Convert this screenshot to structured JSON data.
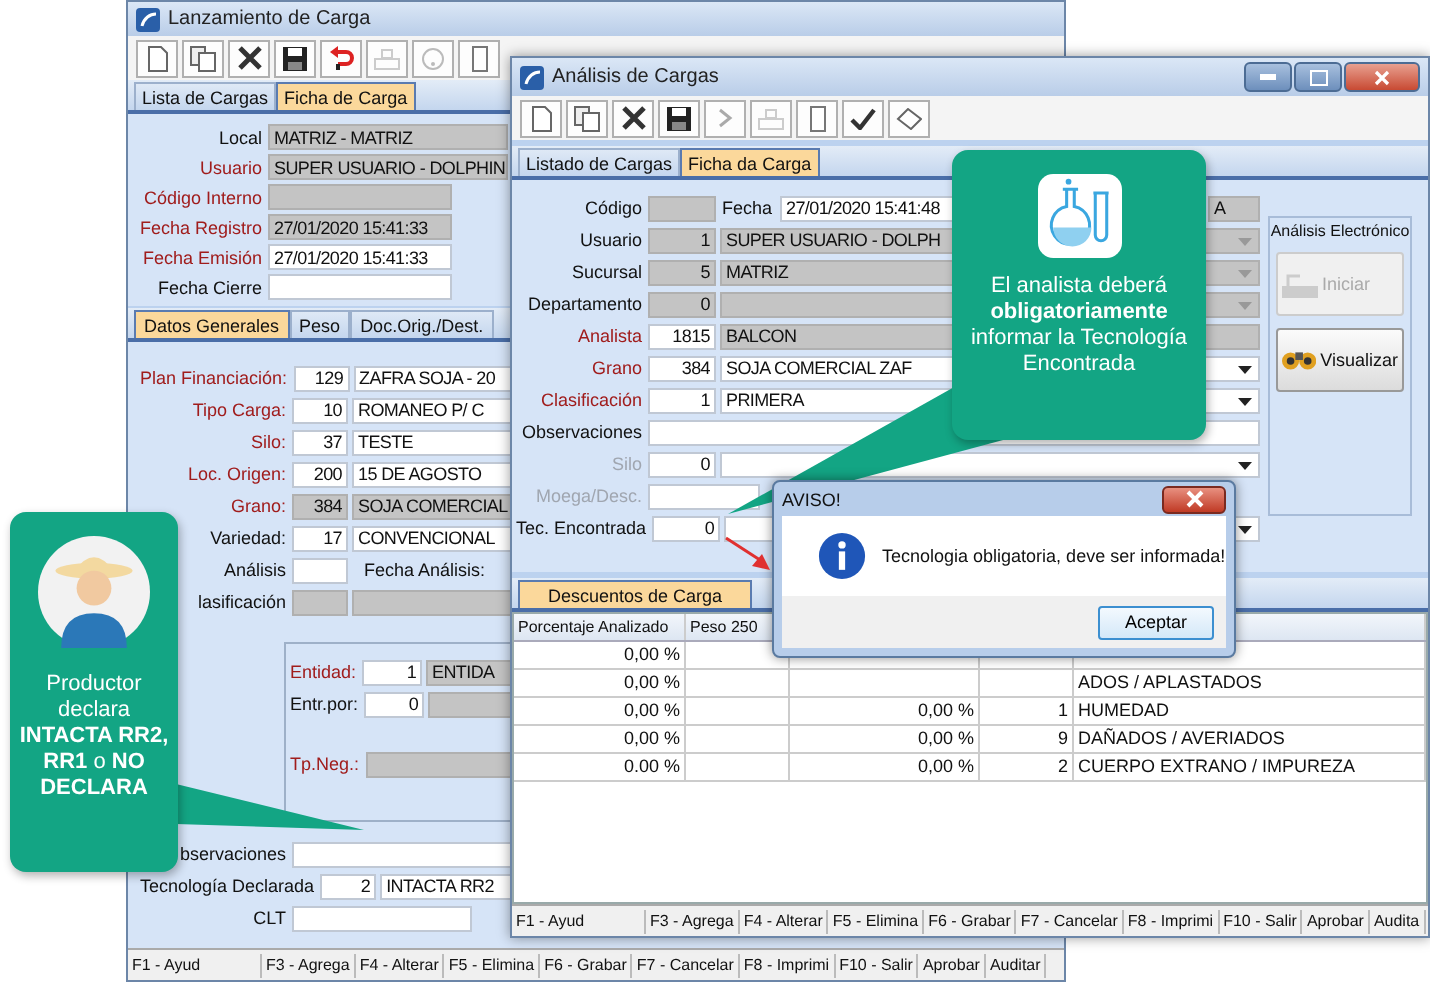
{
  "left_window": {
    "title": "Lanzamiento de Carga",
    "tabs": [
      {
        "label": "Lista de Cargas",
        "selected": false
      },
      {
        "label": "Ficha de Carga",
        "selected": true
      }
    ],
    "header_fields": [
      {
        "label": "Local",
        "required": false,
        "parts": [
          {
            "kind": "text",
            "value": "MATRIZ - MATRIZ",
            "readonly": true
          }
        ]
      },
      {
        "label": "Usuario",
        "required": true,
        "parts": [
          {
            "kind": "text",
            "value": "SUPER USUARIO - DOLPHIN",
            "readonly": true
          }
        ]
      },
      {
        "label": "Código Interno",
        "required": true,
        "parts": [
          {
            "kind": "date",
            "readonly": true
          }
        ]
      },
      {
        "label": "Fecha Registro",
        "required": true,
        "parts": [
          {
            "kind": "date",
            "value": "27/01/2020 15:41:33",
            "readonly": true
          }
        ]
      },
      {
        "label": "Fecha Emisión",
        "required": true,
        "parts": [
          {
            "kind": "date",
            "value": "27/01/2020 15:41:33",
            "readonly": false
          }
        ]
      },
      {
        "label": "Fecha Cierre",
        "required": false,
        "parts": [
          {
            "kind": "date",
            "readonly": false
          }
        ]
      }
    ],
    "subtabs": [
      {
        "label": "Datos Generales",
        "selected": true
      },
      {
        "label": "Peso",
        "selected": false
      },
      {
        "label": "Doc.Orig./Dest.",
        "selected": false
      }
    ],
    "fields": [
      {
        "label": "Plan Financiación:",
        "required": true,
        "parts": [
          {
            "kind": "code",
            "value": "129",
            "readonly": false
          },
          {
            "kind": "text",
            "value": "ZAFRA SOJA - 20",
            "readonly": false
          }
        ]
      },
      {
        "label": "Tipo Carga:",
        "required": true,
        "parts": [
          {
            "kind": "code",
            "value": "10",
            "readonly": false
          },
          {
            "kind": "text",
            "value": "ROMANEO P/ C",
            "readonly": false
          }
        ]
      },
      {
        "label": "Silo:",
        "required": true,
        "parts": [
          {
            "kind": "code",
            "value": "37",
            "readonly": false
          },
          {
            "kind": "text",
            "value": "TESTE",
            "readonly": false
          }
        ]
      },
      {
        "label": "Loc. Origen:",
        "required": true,
        "parts": [
          {
            "kind": "code",
            "value": "200",
            "readonly": false
          },
          {
            "kind": "text",
            "value": "15 DE AGOSTO",
            "readonly": false
          }
        ]
      },
      {
        "label": "Grano:",
        "required": true,
        "parts": [
          {
            "kind": "code",
            "value": "384",
            "readonly": true
          },
          {
            "kind": "text",
            "value": "SOJA COMERCIAL",
            "readonly": true
          }
        ]
      },
      {
        "label": "Variedad:",
        "required": false,
        "parts": [
          {
            "kind": "code",
            "value": "17",
            "readonly": false
          },
          {
            "kind": "text",
            "value": "CONVENCIONAL",
            "readonly": false
          }
        ]
      },
      {
        "label": "Análisis",
        "required": false,
        "parts": [
          {
            "kind": "code",
            "readonly": false
          },
          {
            "kind": "label",
            "value": "Fecha Análisis:"
          }
        ]
      },
      {
        "label": "lasificación",
        "required": false,
        "parts": [
          {
            "kind": "code",
            "readonly": true
          },
          {
            "kind": "text",
            "readonly": true
          }
        ]
      }
    ],
    "entity_group": [
      {
        "label": "Entidad:",
        "required": true,
        "parts": [
          {
            "kind": "code",
            "value": "1",
            "readonly": false
          },
          {
            "kind": "text",
            "value": "ENTIDA",
            "readonly": true
          }
        ]
      },
      {
        "label": "Entr.por:",
        "required": false,
        "parts": [
          {
            "kind": "code",
            "value": "0",
            "readonly": false
          },
          {
            "kind": "text",
            "readonly": true
          }
        ]
      },
      {
        "label": "Tp.Neg.:",
        "required": true,
        "parts": [
          {
            "kind": "text",
            "readonly": true
          }
        ]
      }
    ],
    "bottom_fields": [
      {
        "label": "bservaciones",
        "required": false,
        "parts": [
          {
            "kind": "text",
            "readonly": false
          }
        ]
      },
      {
        "label": "Tecnología Declarada",
        "required": false,
        "parts": [
          {
            "kind": "code",
            "value": "2",
            "readonly": false
          },
          {
            "kind": "text",
            "value": "INTACTA RR2",
            "readonly": false
          }
        ]
      },
      {
        "label": "CLT",
        "required": false,
        "parts": [
          {
            "kind": "date",
            "readonly": false
          }
        ]
      }
    ],
    "status_bar": [
      "F1 - Ayud",
      "F3 - Agrega",
      "F4 - Alterar",
      "F5 - Elimina",
      "F6 - Grabar",
      "F7 - Cancelar",
      "F8 - Imprimi",
      "F10 - Salir",
      "Aprobar",
      "Auditar"
    ]
  },
  "right_window": {
    "title": "Análisis de Cargas",
    "tabs": [
      {
        "label": "Listado de Cargas",
        "selected": false
      },
      {
        "label": "Ficha da Carga",
        "selected": true
      }
    ],
    "fields": [
      {
        "label": "Código",
        "required": false,
        "disabled": false,
        "parts": [
          {
            "kind": "code",
            "readonly": true
          },
          {
            "kind": "label",
            "value": "Fecha"
          },
          {
            "kind": "date",
            "value": "27/01/2020 15:41:48",
            "readonly": false
          },
          {
            "kind": "tail",
            "value": "A",
            "readonly": true
          }
        ]
      },
      {
        "label": "Usuario",
        "required": false,
        "disabled": false,
        "parts": [
          {
            "kind": "code",
            "value": "1",
            "readonly": true
          },
          {
            "kind": "text",
            "value": "SUPER USUARIO - DOLPH",
            "readonly": true,
            "dropdown": true
          }
        ]
      },
      {
        "label": "Sucursal",
        "required": false,
        "disabled": false,
        "parts": [
          {
            "kind": "code",
            "value": "5",
            "readonly": true
          },
          {
            "kind": "text",
            "value": "MATRIZ",
            "readonly": true,
            "dropdown": true
          }
        ]
      },
      {
        "label": "Departamento",
        "required": false,
        "disabled": false,
        "parts": [
          {
            "kind": "code",
            "value": "0",
            "readonly": true
          },
          {
            "kind": "text",
            "readonly": true,
            "dropdown": true
          }
        ]
      },
      {
        "label": "Analista",
        "required": true,
        "disabled": false,
        "parts": [
          {
            "kind": "code",
            "value": "1815",
            "readonly": false
          },
          {
            "kind": "text",
            "value": "BALCON",
            "readonly": true
          }
        ]
      },
      {
        "label": "Grano",
        "required": true,
        "disabled": false,
        "parts": [
          {
            "kind": "code",
            "value": "384",
            "readonly": false
          },
          {
            "kind": "text",
            "value": "SOJA COMERCIAL ZAF",
            "readonly": false,
            "dropdown": true
          }
        ]
      },
      {
        "label": "Clasificación",
        "required": true,
        "disabled": false,
        "parts": [
          {
            "kind": "code",
            "value": "1",
            "readonly": false
          },
          {
            "kind": "text",
            "value": "PRIMERA",
            "readonly": false,
            "dropdown": true
          }
        ]
      },
      {
        "label": "Observaciones",
        "required": false,
        "disabled": false,
        "parts": [
          {
            "kind": "text",
            "readonly": false
          }
        ]
      },
      {
        "label": "Silo",
        "required": false,
        "disabled": true,
        "parts": [
          {
            "kind": "code",
            "value": "0",
            "readonly": false
          },
          {
            "kind": "text",
            "readonly": false,
            "dropdown": true
          }
        ]
      },
      {
        "label": "Moega/Desc.",
        "required": false,
        "disabled": true,
        "parts": [
          {
            "kind": "wide",
            "readonly": false
          }
        ]
      },
      {
        "label": "Tec. Encontrada",
        "required": false,
        "disabled": false,
        "parts": [
          {
            "kind": "code",
            "value": "0",
            "readonly": false
          },
          {
            "kind": "text",
            "readonly": false,
            "dropdown": true
          }
        ]
      }
    ],
    "analysis_panel": {
      "title": "Análisis Electrónico",
      "buttons": [
        {
          "label": "Iniciar",
          "disabled": true
        },
        {
          "label": "Visualizar",
          "disabled": false
        }
      ]
    },
    "lower_tabs": [
      {
        "label": "Descuentos de Carga",
        "selected": true
      }
    ],
    "table": {
      "columns": [
        "Porcentaje Analizado",
        "Peso 250"
      ],
      "rows": [
        {
          "percent": "0,00 %"
        },
        {
          "percent": "0,00 %",
          "column_5": "ADOS / APLASTADOS"
        },
        {
          "percent": "0,00 %",
          "column_3": "0,00 %",
          "column_4": "1",
          "column_5": "HUMEDAD"
        },
        {
          "percent": "0,00 %",
          "column_3": "0,00 %",
          "column_4": "9",
          "column_5": "DAÑADOS / AVERIADOS"
        },
        {
          "percent": "0.00 %",
          "column_3": "0,00 %",
          "column_4": "2",
          "column_5": "CUERPO EXTRANO / IMPUREZA"
        }
      ]
    },
    "status_bar": [
      "F1 - Ayud",
      "F3 - Agrega",
      "F4 - Alterar",
      "F5 - Elimina",
      "F6 - Grabar",
      "F7 - Cancelar",
      "F8 - Imprimi",
      "F10 - Salir",
      "Aprobar",
      "Audita"
    ]
  },
  "dialog": {
    "title": "AVISO!",
    "message": "Tecnologia obligatoria, deve ser informada!",
    "button": "Aceptar"
  },
  "callouts": [
    {
      "kind": "producer",
      "text": "Productor declara **INTACTA RR2, RR1** o **NO DECLARA**"
    },
    {
      "kind": "analyst",
      "text": "El analista deberá **obligatoriamente** informar la Tecnología Encontrada"
    }
  ]
}
